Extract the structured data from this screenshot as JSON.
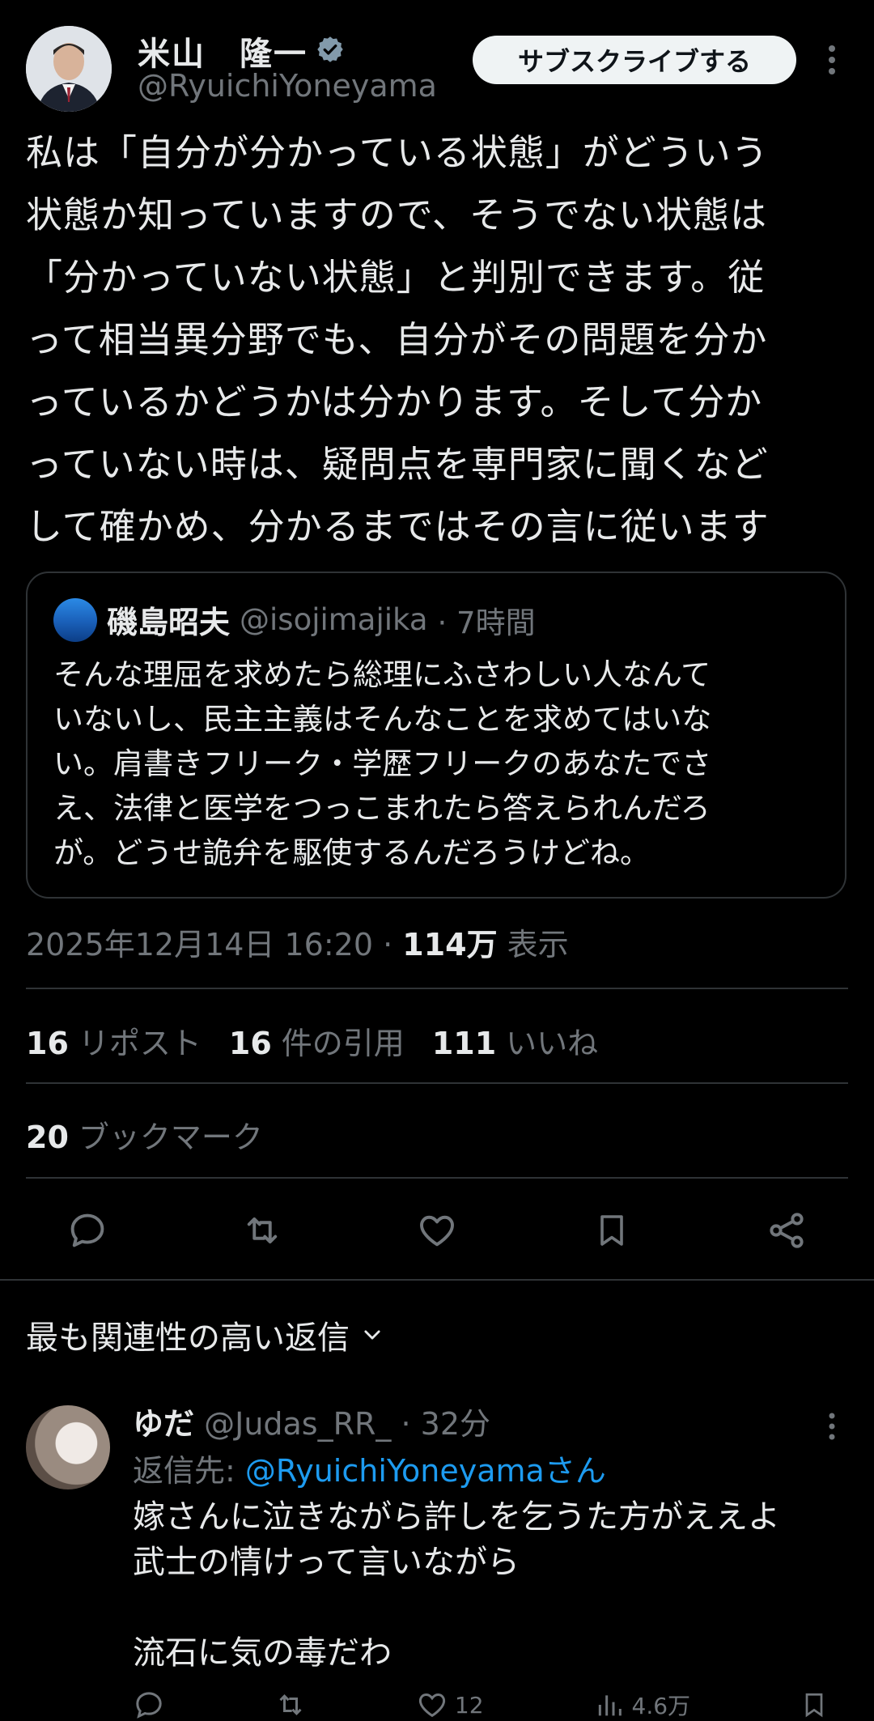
{
  "author": {
    "name": "米山　隆一",
    "handle": "@RyuichiYoneyama"
  },
  "subscribe_label": "サブスクライブする",
  "post": {
    "text": "私は「自分が分かっている状態」がどういう\n状態か知っていますので、そうでない状態は\n「分かっていない状態」と判別できます。従\nって相当異分野でも、自分がその問題を分か\nっているかどうかは分かります。そして分か\nっていない時は、疑問点を専門家に聞くなど\nして確かめ、分かるまではその言に従います"
  },
  "quote": {
    "name": "磯島昭夫",
    "handle": "@isojimajika",
    "time": "· 7時間",
    "text": "そんな理屈を求めたら総理にふさわしい人なんて\nいないし、民主主義はそんなことを求めてはいな\nい。肩書きフリーク・学歴フリークのあなたでさ\nえ、法律と医学をつっこまれたら答えられんだろ\nが。どうせ詭弁を駆使するんだろうけどね。"
  },
  "meta": {
    "datetime": "2025年12月14日 16:20 · ",
    "views": "114万",
    "views_label": " 表示"
  },
  "stats": {
    "reposts": "16",
    "reposts_label": "リポスト",
    "quotes": "16",
    "quotes_label": "件の引用",
    "likes": "111",
    "likes_label": "いいね",
    "bookmarks": "20",
    "bookmarks_label": "ブックマーク"
  },
  "replies_sort_label": "最も関連性の高い返信",
  "reply": {
    "name": "ゆだ",
    "handle": "@Judas_RR_",
    "time": "· 32分",
    "reply_to_prefix": "返信先: ",
    "reply_to_handle": "@RyuichiYoneyama",
    "reply_to_suffix": "さん",
    "text": "嫁さんに泣きながら許しを乞うた方がええよ\n武士の情けって言いながら\n\n流石に気の毒だわ",
    "likes_partial": "12",
    "views_partial": "4.6万"
  },
  "colors": {
    "background": "#000000",
    "text": "#e7e9ea",
    "muted": "#71767b",
    "link": "#1d9bf0",
    "divider": "#2f3336",
    "verified": "#829aab"
  },
  "icons": {
    "verified": "verified-badge-icon",
    "more": "more-vertical-icon",
    "reply": "reply-icon",
    "repost": "repost-icon",
    "like": "heart-icon",
    "bookmark": "bookmark-icon",
    "share": "share-icon",
    "chevron": "chevron-down-icon"
  }
}
